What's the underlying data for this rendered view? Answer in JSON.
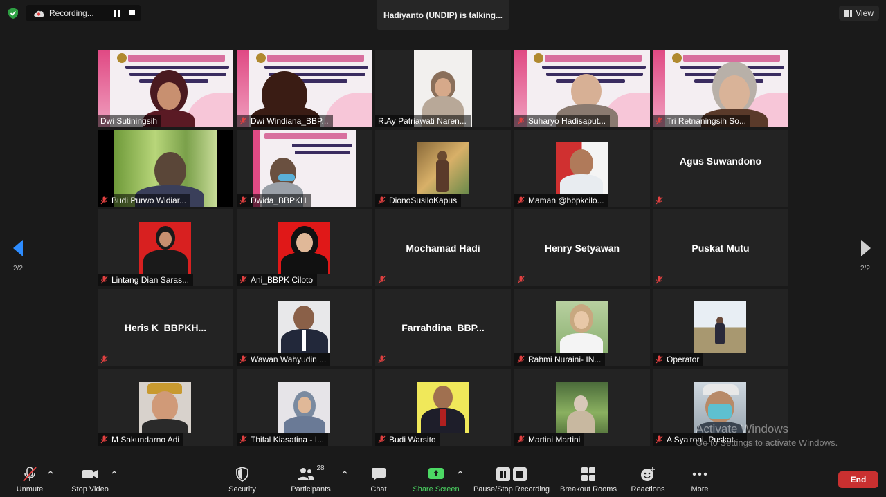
{
  "top": {
    "recording_label": "Recording...",
    "talking": "Hadiyanto (UNDIP) is talking...",
    "view_label": "View"
  },
  "pager": {
    "left": "2/2",
    "right": "2/2"
  },
  "tiles": [
    {
      "name": "Dwi Sutiningsih"
    },
    {
      "name": "Dwi Windiana_BBP..."
    },
    {
      "name": "R.Ay Patriawati Naren..."
    },
    {
      "name": "Suharyo Hadisaput..."
    },
    {
      "name": "Tri Retnaningsih So..."
    },
    {
      "name": "Budi Purwo Widiar..."
    },
    {
      "name": "Dwida_BBPKH"
    },
    {
      "name": "DionoSusiloKapus"
    },
    {
      "name": "Maman @bbpkcilo..."
    },
    {
      "name": "Agus Suwandono"
    },
    {
      "name": "Lintang Dian Saras..."
    },
    {
      "name": "Ani_BBPK Ciloto"
    },
    {
      "name": "Mochamad Hadi"
    },
    {
      "name": "Henry Setyawan"
    },
    {
      "name": "Puskat Mutu"
    },
    {
      "name": "Heris  K_BBPKH..."
    },
    {
      "name": "Wawan Wahyudin ..."
    },
    {
      "name": "Farrahdina_BBP..."
    },
    {
      "name": "Rahmi Nuraini- IN..."
    },
    {
      "name": "Operator"
    },
    {
      "name": "M Sakundarno Adi"
    },
    {
      "name": "Thifal Kiasatina - I..."
    },
    {
      "name": "Budi Warsito"
    },
    {
      "name": "Martini Martini"
    },
    {
      "name": "A Sya'roni_Puskat ..."
    }
  ],
  "slide_text": {
    "title": "MAGISTER EPIDEMIOLOGI",
    "subtitle": "WORKSHOP :",
    "body": "\"Inisiasi Pelatihan Epidemiologi Lapangan Bergelar-Berbasis Modul\""
  },
  "watermark": {
    "line1": "Activate Windows",
    "line2": "Go to Settings to activate Windows."
  },
  "toolbar": {
    "unmute": "Unmute",
    "stop_video": "Stop Video",
    "security": "Security",
    "participants": "Participants",
    "participants_count": "28",
    "chat": "Chat",
    "share_screen": "Share Screen",
    "pause_stop_recording": "Pause/Stop Recording",
    "breakout_rooms": "Breakout Rooms",
    "reactions": "Reactions",
    "more": "More",
    "end": "End"
  },
  "colors": {
    "share_green": "#4cd964",
    "end_red": "#c93030",
    "muted_red": "#e04040"
  }
}
